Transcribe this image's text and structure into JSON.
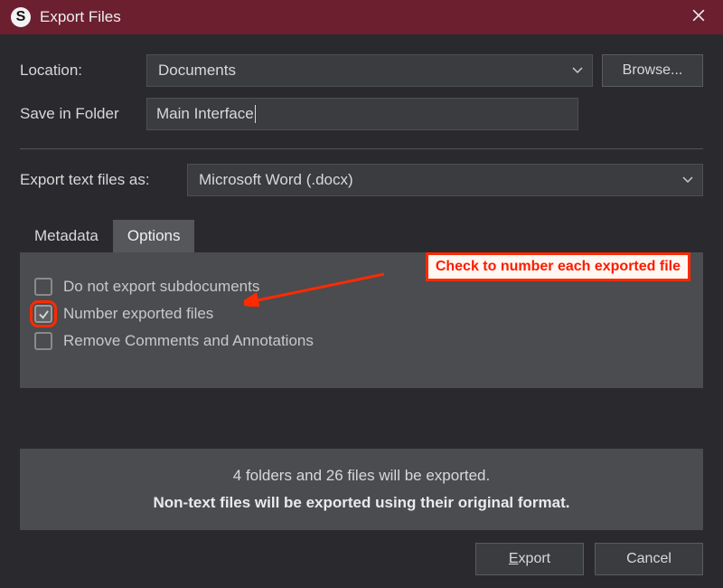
{
  "titlebar": {
    "title": "Export Files"
  },
  "location": {
    "label": "Location:",
    "value": "Documents",
    "browse_label": "Browse..."
  },
  "folder": {
    "label": "Save in Folder",
    "value": "Main Interface"
  },
  "format": {
    "label": "Export text files as:",
    "value": "Microsoft Word (.docx)"
  },
  "tabs": {
    "metadata": "Metadata",
    "options": "Options"
  },
  "options": {
    "subdocs": "Do not export subdocuments",
    "number": "Number exported files",
    "remove": "Remove Comments and Annotations"
  },
  "annotation": {
    "text": "Check to number each exported file"
  },
  "status": {
    "line1": "4 folders and 26 files will be exported.",
    "line2": "Non-text files will be exported using their original format."
  },
  "buttons": {
    "export_u": "E",
    "export_rest": "xport",
    "cancel": "Cancel"
  }
}
